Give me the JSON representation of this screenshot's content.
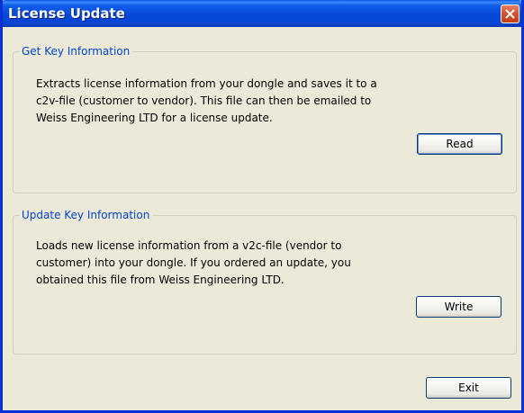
{
  "window": {
    "title": "License Update",
    "close_label": "Close"
  },
  "get_key": {
    "legend": "Get Key Information",
    "description_lines": [
      "Extracts license information from your dongle and saves it to a",
      "c2v-file (customer to vendor). This file can then be emailed to",
      "Weiss Engineering LTD for a license update."
    ],
    "button_label": "Read"
  },
  "update_key": {
    "legend": "Update Key Information",
    "description_lines": [
      "Loads new license information from a v2c-file (vendor to",
      "customer) into your dongle. If you ordered an update, you",
      "obtained this file from Weiss Engineering LTD."
    ],
    "button_label": "Write"
  },
  "footer": {
    "exit_label": "Exit"
  },
  "colors": {
    "titlebar": "#0548d8",
    "window_bg": "#ece9d8",
    "legend_text": "#0046d5",
    "close_button": "#d6502d"
  },
  "icons": {
    "close": "close-icon"
  }
}
